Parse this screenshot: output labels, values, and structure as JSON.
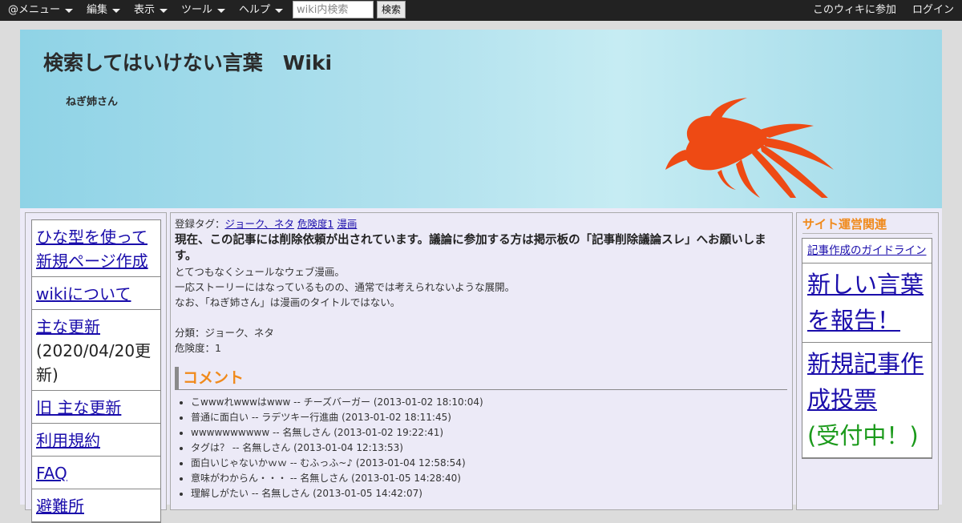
{
  "topbar": {
    "menu_atmenu": "@メニュー",
    "menu_edit": "編集",
    "menu_view": "表示",
    "menu_tools": "ツール",
    "menu_help": "ヘルプ",
    "search_placeholder": "wiki内検索",
    "search_button": "検索",
    "join_link": "このウィキに参加",
    "login_link": "ログイン"
  },
  "header": {
    "title": "検索してはいけない言葉　Wiki",
    "subtitle": "ねぎ姉さん"
  },
  "left_nav": {
    "items": [
      {
        "label": "ひな型を使って新規ページ作成"
      },
      {
        "label": "wikiについて"
      },
      {
        "label": "主な更新",
        "note": "(2020/04/20更新)"
      },
      {
        "label": "旧 主な更新"
      },
      {
        "label": "利用規約"
      },
      {
        "label": "FAQ"
      },
      {
        "label": "避難所"
      }
    ]
  },
  "article": {
    "tags_label": "登録タグ：",
    "tags": [
      "ジョーク、ネタ",
      "危険度1",
      "漫画"
    ],
    "notice": "現在、この記事には削除依頼が出されています。議論に参加する方は掲示板の「記事削除議論スレ」へお願いします。",
    "lines": [
      "とてつもなくシュールなウェブ漫画。",
      "一応ストーリーにはなっているものの、通常では考えられないような展開。",
      "なお、「ねぎ姉さん」は漫画のタイトルではない。"
    ],
    "category": "分類：ジョーク、ネタ",
    "danger": "危険度：1",
    "comment_heading": "コメント",
    "comments": [
      "こwwwれwwwはwww -- チーズバーガー (2013-01-02 18:10:04)",
      "普通に面白い -- ラデツキー行進曲 (2013-01-02 18:11:45)",
      "wwwwwwwwww -- 名無しさん (2013-01-02 19:22:41)",
      "タグは？ -- 名無しさん (2013-01-04 12:13:53)",
      "面白いじゃないかｗｗ -- むふっふ~♪ (2013-01-04 12:58:54)",
      "意味がわからん・・・ -- 名無しさん (2013-01-05 14:28:40)",
      "理解しがたい -- 名無しさん (2013-01-05 14:42:07)"
    ]
  },
  "right_nav": {
    "heading": "サイト運営関連",
    "guideline": "記事作成のガイドライン",
    "report": "新しい言葉を報告！",
    "vote": "新規記事作成投票",
    "vote_status": "(受付中！)"
  },
  "colors": {
    "accent": "#f08a1c",
    "link": "#1a0dab",
    "fish": "#ee4a14"
  }
}
